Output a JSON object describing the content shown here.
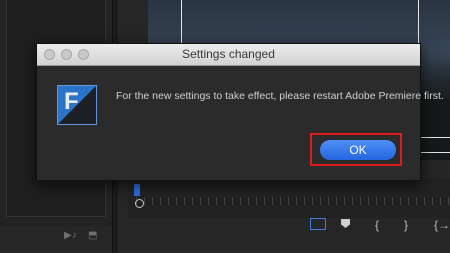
{
  "dialog": {
    "title": "Settings changed",
    "message": "For the new settings to take effect, please restart Adobe Premiere first.",
    "ok_label": "OK",
    "app_icon_letter": "F",
    "highlight_color": "#e01b1b",
    "button_color": "#2f74e6"
  },
  "background": {
    "timeline_tools": [
      "{",
      "}",
      "{→"
    ]
  }
}
